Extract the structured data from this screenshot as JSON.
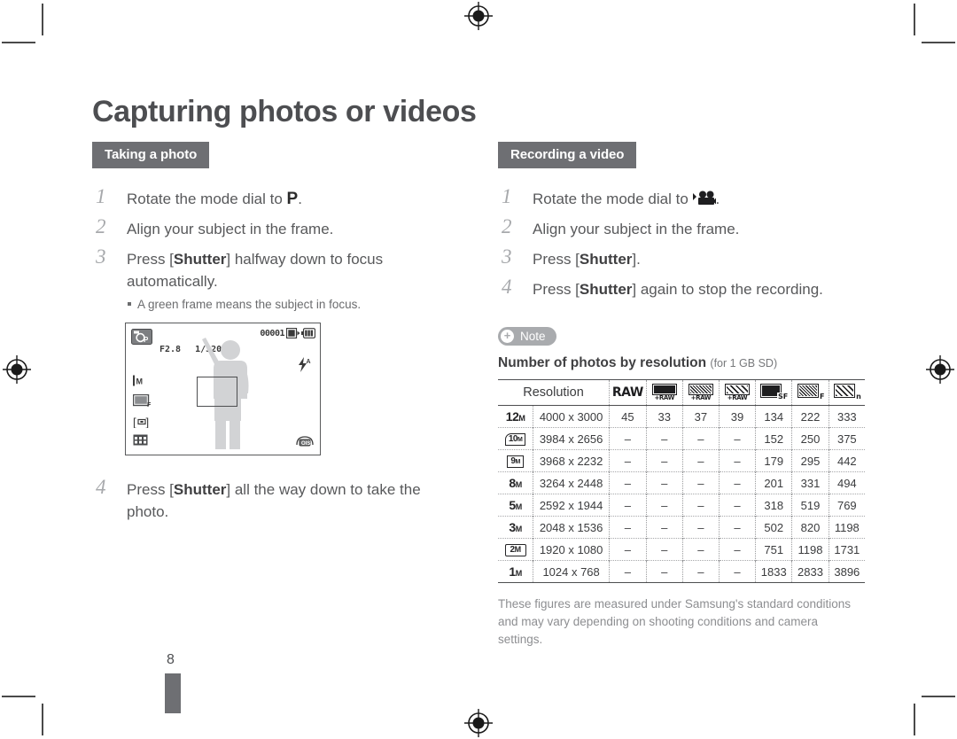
{
  "page": {
    "title": "Capturing photos or videos",
    "number": "8"
  },
  "left_column": {
    "section_label": "Taking a photo",
    "steps": [
      {
        "num": "1",
        "pre": "Rotate the mode dial to ",
        "icon": "mode-p",
        "post": "."
      },
      {
        "num": "2",
        "pre": "Align your subject in the frame.",
        "icon": "",
        "post": ""
      },
      {
        "num": "3",
        "pre": "Press [",
        "kb": "Shutter",
        "post": "] halfway down to focus automatically."
      },
      {
        "num": "4",
        "pre": "Press [",
        "kb": "Shutter",
        "post": "] all the way down to take the photo."
      }
    ],
    "step3_subnote": "A green frame means the subject in focus.",
    "lcd": {
      "mode_icon": "program-mode-icon",
      "aperture": "F2.8",
      "shutter_speed": "1/320",
      "frame_counter": "00001",
      "card_icon": "memory-card-icon",
      "battery_icon": "battery-full-icon",
      "flash_icon": "flash-auto-icon",
      "left_icons": [
        "metering-icon",
        "image-quality-icon",
        "focus-area-icon"
      ],
      "grid_icon": "grid-icon",
      "shake_icon": "anti-shake-icon"
    }
  },
  "right_column": {
    "section_label": "Recording a video",
    "steps": [
      {
        "num": "1",
        "pre": "Rotate the mode dial to ",
        "icon": "mode-movie",
        "post": "."
      },
      {
        "num": "2",
        "pre": "Align your subject in the frame.",
        "icon": "",
        "post": ""
      },
      {
        "num": "3",
        "pre": "Press [",
        "kb": "Shutter",
        "post": "]."
      },
      {
        "num": "4",
        "pre": "Press [",
        "kb": "Shutter",
        "post": "] again to stop the recording."
      }
    ],
    "note_badge": "Note",
    "note_title": "Number of photos by resolution",
    "note_title_sub": "(for 1 GB SD)",
    "footnote": "These figures are measured under Samsung's standard conditions and may vary depending on shooting conditions and camera settings."
  },
  "resolution_table": {
    "header_resolution": "Resolution",
    "quality_headers": [
      {
        "name": "raw",
        "label": "RAW",
        "sub": ""
      },
      {
        "name": "superfine-plus-raw",
        "label": "",
        "sub": "+RAW",
        "fill": "solid"
      },
      {
        "name": "fine-plus-raw",
        "label": "",
        "sub": "+RAW",
        "fill": "dense"
      },
      {
        "name": "normal-plus-raw",
        "label": "",
        "sub": "+RAW",
        "fill": "coarse"
      },
      {
        "name": "superfine",
        "label": "",
        "sub": "SF",
        "fill": "solid"
      },
      {
        "name": "fine",
        "label": "",
        "sub": "F",
        "fill": "dense"
      },
      {
        "name": "normal",
        "label": "",
        "sub": "n",
        "fill": "coarse"
      }
    ],
    "rows": [
      {
        "badge": "12",
        "badge_style": "plain",
        "dimensions": "4000 x 3000",
        "values": [
          "45",
          "33",
          "37",
          "39",
          "134",
          "222",
          "333"
        ]
      },
      {
        "badge": "10",
        "badge_style": "framed",
        "dimensions": "3984 x 2656",
        "values": [
          "–",
          "–",
          "–",
          "–",
          "152",
          "250",
          "375"
        ]
      },
      {
        "badge": "9",
        "badge_style": "framed",
        "dimensions": "3968 x 2232",
        "values": [
          "–",
          "–",
          "–",
          "–",
          "179",
          "295",
          "442"
        ]
      },
      {
        "badge": "8",
        "badge_style": "plain",
        "dimensions": "3264 x 2448",
        "values": [
          "–",
          "–",
          "–",
          "–",
          "201",
          "331",
          "494"
        ]
      },
      {
        "badge": "5",
        "badge_style": "plain",
        "dimensions": "2592 x 1944",
        "values": [
          "–",
          "–",
          "–",
          "–",
          "318",
          "519",
          "769"
        ]
      },
      {
        "badge": "3",
        "badge_style": "plain",
        "dimensions": "2048 x 1536",
        "values": [
          "–",
          "–",
          "–",
          "–",
          "502",
          "820",
          "1198"
        ]
      },
      {
        "badge": "2",
        "badge_style": "wide",
        "dimensions": "1920 x 1080",
        "values": [
          "–",
          "–",
          "–",
          "–",
          "751",
          "1198",
          "1731"
        ]
      },
      {
        "badge": "1",
        "badge_style": "plain",
        "dimensions": "1024 x 768",
        "values": [
          "–",
          "–",
          "–",
          "–",
          "1833",
          "2833",
          "3896"
        ]
      }
    ]
  },
  "colors": {
    "band": "#6e6f73",
    "text": "#58595b",
    "title": "#4d4e51",
    "note_badge": "#a9abae",
    "footnote": "#8d8e91"
  }
}
